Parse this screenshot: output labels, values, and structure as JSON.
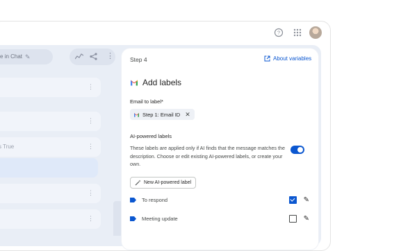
{
  "background_canvas": {
    "chip_text": "e in Chat",
    "rows": [
      {
        "text": ""
      },
      {
        "text": ""
      },
      {
        "text": "s True"
      },
      {
        "text": ""
      },
      {
        "text": ""
      },
      {
        "text": ""
      }
    ]
  },
  "panel": {
    "step_label": "Step 4",
    "about_link": "About variables",
    "title": "Add labels",
    "email_field": {
      "label": "Email to label*",
      "chip_text": "Step 1: Email ID"
    },
    "ai_section": {
      "heading": "AI-powered labels",
      "description": "These labels are applied only if AI finds that the message matches the description. Choose or edit existing AI-powered labels, or create your own.",
      "toggle_on": true
    },
    "new_button": "New AI-powered label",
    "labels": [
      {
        "name": "To respond",
        "checked": true
      },
      {
        "name": "Meeting update",
        "checked": false
      }
    ]
  },
  "colors": {
    "accent": "#0b57d0",
    "canvas": "#e9eef6"
  }
}
